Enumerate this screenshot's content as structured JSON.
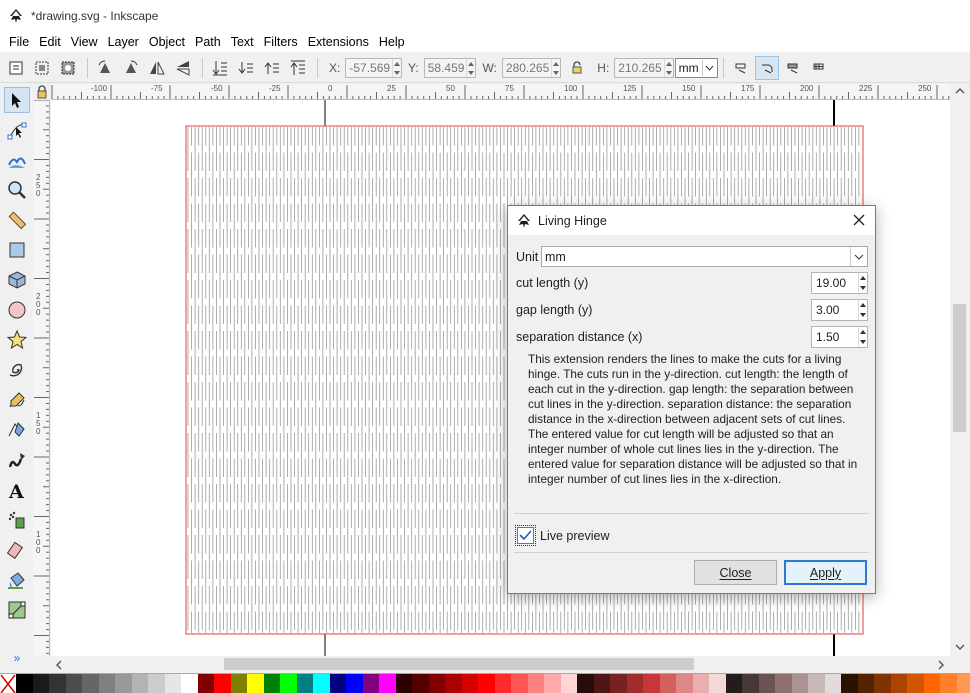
{
  "window": {
    "title": "*drawing.svg - Inkscape"
  },
  "menu": [
    "File",
    "Edit",
    "View",
    "Layer",
    "Object",
    "Path",
    "Text",
    "Filters",
    "Extensions",
    "Help"
  ],
  "toolbar": {
    "x_label": "X:",
    "x_value": "-57.569",
    "y_label": "Y:",
    "y_value": "58.459",
    "w_label": "W:",
    "w_value": "280.265",
    "h_label": "H:",
    "h_value": "210.265",
    "unit": "mm"
  },
  "ruler_h_labels": [
    "-100",
    "-75",
    "-50",
    "-25",
    "0",
    "25",
    "50",
    "75",
    "100",
    "125",
    "150",
    "175",
    "200",
    "225",
    "250"
  ],
  "ruler_v_labels": [
    "250",
    "200",
    "150",
    "100"
  ],
  "dialog": {
    "title": "Living Hinge",
    "unit_label": "Unit",
    "unit_value": "mm",
    "cut_length_label": "cut length (y)",
    "cut_length_value": "19.00",
    "gap_length_label": "gap length (y)",
    "gap_length_value": "3.00",
    "separation_label": "separation distance (x)",
    "separation_value": "1.50",
    "description": "This extension renders the lines to make the cuts for a living hinge. The cuts run in the y-direction. cut length: the length of each cut in the y-direction. gap length: the separation between cut lines in the y-direction. separation distance: the separation distance in the x-direction between adjacent sets of cut lines. The entered value for cut length will be adjusted so that an integer number of whole cut lines lies in the y-direction. The entered value for separation distance will be adjusted so that in integer number of cut lines lies in the x-direction.",
    "live_preview_label": "Live preview",
    "live_preview_checked": true,
    "close_label": "Close",
    "apply_label": "Apply"
  },
  "colors": {
    "accent": "#3c88cf",
    "hinge_lines": "#9a9a9a",
    "page_border": "#e04040"
  },
  "palette": [
    "#000000",
    "#1a1a1a",
    "#333333",
    "#4d4d4d",
    "#666666",
    "#808080",
    "#999999",
    "#b3b3b3",
    "#cccccc",
    "#e6e6e6",
    "#ffffff",
    "#800000",
    "#ff0000",
    "#808000",
    "#ffff00",
    "#008000",
    "#00ff00",
    "#008080",
    "#00ffff",
    "#000080",
    "#0000ff",
    "#800080",
    "#ff00ff",
    "#2b0000",
    "#550000",
    "#800000",
    "#aa0000",
    "#d40000",
    "#ff0000",
    "#ff2a2a",
    "#ff5555",
    "#ff8080",
    "#ffaaaa",
    "#ffd5d5",
    "#280b0b",
    "#501616",
    "#782121",
    "#a02c2c",
    "#c83737",
    "#d35f5f",
    "#de8787",
    "#e9afaf",
    "#f4d7d7",
    "#241c1c",
    "#483737",
    "#6c5353",
    "#916f6f",
    "#ac9393",
    "#c8b7b7",
    "#e3dbdb",
    "#2b1100",
    "#552200",
    "#803300",
    "#aa4400",
    "#d45500",
    "#ff6600",
    "#ff7f2a",
    "#ff9955"
  ]
}
